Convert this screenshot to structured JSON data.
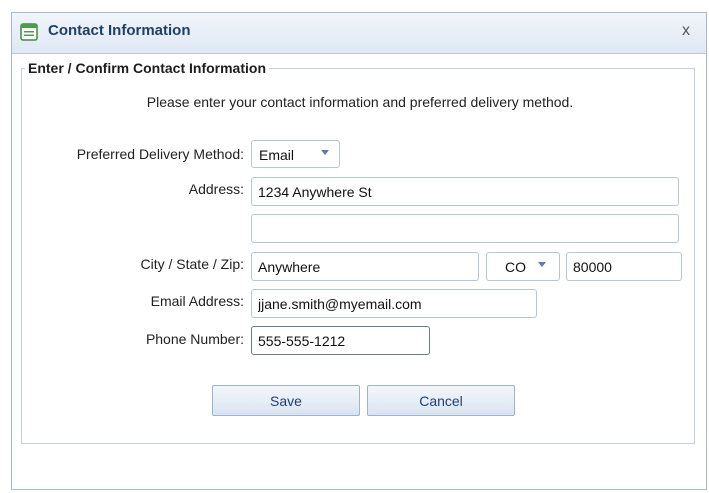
{
  "window": {
    "title": "Contact Information",
    "close_glyph": "x"
  },
  "group": {
    "legend": "Enter / Confirm Contact Information"
  },
  "instructions": "Please enter your contact information and preferred delivery method.",
  "form": {
    "delivery": {
      "label": "Preferred Delivery Method:",
      "selected": "Email"
    },
    "address": {
      "label": "Address:",
      "line1": "1234 Anywhere St",
      "line2": ""
    },
    "city_state_zip": {
      "label": "City / State / Zip:",
      "city": "Anywhere",
      "state": "CO",
      "zip": "80000"
    },
    "email": {
      "label": "Email Address:",
      "value": "jjane.smith@myemail.com"
    },
    "phone": {
      "label": "Phone Number:",
      "value": "555-555-1212"
    }
  },
  "buttons": {
    "save": "Save",
    "cancel": "Cancel"
  },
  "colors": {
    "title": "#1e3f6e",
    "accent": "#5a7bb0",
    "border": "#b9c6d6"
  },
  "icons": {
    "app": "form-window-icon",
    "close": "close-icon",
    "dropdown": "chevron-down-icon"
  }
}
